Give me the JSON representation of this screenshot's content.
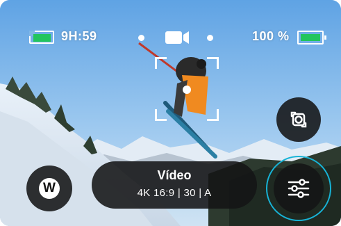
{
  "status": {
    "remaining_time": "9H:59",
    "battery_percent": "100 %"
  },
  "mode": {
    "title": "Vídeo",
    "settings": "4K 16:9 | 30 | A"
  },
  "controls": {
    "lens_button_icon": "lens-cycle-icon",
    "widget_button_letter": "W",
    "settings_button_icon": "sliders-icon"
  },
  "colors": {
    "sd_fill": "#22c55e",
    "battery_fill": "#22c55e",
    "settings_ring": "#17b3d6"
  }
}
